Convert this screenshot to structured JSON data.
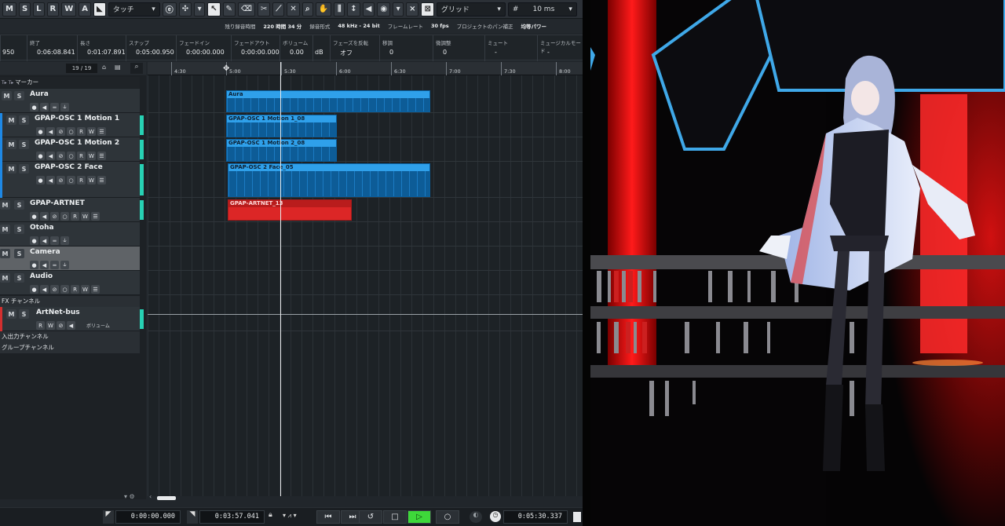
{
  "toolbar": {
    "buttons": [
      "M",
      "S",
      "L",
      "R",
      "W",
      "A"
    ],
    "automation_mode": "タッチ",
    "snap_type": "グリッド",
    "quantize": "10 ms"
  },
  "status": {
    "rec_time_label": "残り録音時間",
    "rec_time_value": "220 時間 34 分",
    "rec_format_label": "録音形式",
    "rec_format_value": "48 kHz - 24 bit",
    "frame_rate_label": "フレームレート",
    "frame_rate_value": "30 fps",
    "pan_label": "プロジェクトのパン補正",
    "pan_value": "均等パワー"
  },
  "infoline": [
    {
      "h": "",
      "v": "950"
    },
    {
      "h": "終了",
      "v": "0:06:08.841"
    },
    {
      "h": "長さ",
      "v": "0:01:07.891"
    },
    {
      "h": "スナップ",
      "v": "0:05:00.950"
    },
    {
      "h": "フェードイン",
      "v": "0:00:00.000"
    },
    {
      "h": "フェードアウト",
      "v": "0:00:00.000"
    },
    {
      "h": "ボリューム",
      "v": "0.00"
    },
    {
      "h": "",
      "v": "dB"
    },
    {
      "h": "フェーズを反転",
      "v": "オフ"
    },
    {
      "h": "移調",
      "v": "0"
    },
    {
      "h": "微調整",
      "v": "0"
    },
    {
      "h": "ミュート",
      "v": "-"
    },
    {
      "h": "ミュージカルモード",
      "v": "-"
    }
  ],
  "track_header": {
    "count": "19 / 19",
    "marker": "マーカー"
  },
  "tracks": [
    {
      "name": "Aura",
      "controls": "● ◀ ═ ⫝"
    },
    {
      "name": "GPAP-OSC 1 Motion 1",
      "controls": "● ◀ ⊘ ○ R W ☰"
    },
    {
      "name": "GPAP-OSC 1 Motion 2",
      "controls": "● ◀ ⊘ ○ R W ☰"
    },
    {
      "name": "GPAP-OSC 2 Face",
      "controls": "● ◀ ⊘ ○ R W ☰"
    },
    {
      "name": "GPAP-ARTNET",
      "controls": "● ◀ ⊘ ○ R W ☰"
    },
    {
      "name": "Otoha",
      "controls": "● ◀ ═ ⫝"
    },
    {
      "name": "Camera",
      "controls": "● ◀ ═ ⫝"
    },
    {
      "name": "Audio",
      "controls": "● ◀ ⊘ ○ R W ☰"
    }
  ],
  "groups": {
    "fx": "FX チャンネル",
    "io": "入出力チャンネル",
    "group": "グループチャンネル"
  },
  "artnet_bus": {
    "name": "ArtNet-bus",
    "volume_label": "ボリューム"
  },
  "ruler": [
    "4:30",
    "5:00",
    "5:30",
    "6:00",
    "6:30",
    "7:00",
    "7:30",
    "8:00"
  ],
  "clips": [
    {
      "name": "Aura"
    },
    {
      "name": "GPAP-OSC 1 Motion 1_08"
    },
    {
      "name": "GPAP-OSC 1 Motion 2_08"
    },
    {
      "name": "GPAP-OSC 2 Face_05"
    },
    {
      "name": "GPAP-ARTNET_13"
    }
  ],
  "transport": {
    "left_locator": "0:00:00.000",
    "right_locator": "0:03:57.041",
    "position": "0:05:30.337"
  },
  "colors": {
    "clip_blue": "#2fa0ea",
    "clip_red": "#dc2626",
    "track_teal": "#27d1b4",
    "play_green": "#3ed83a"
  }
}
